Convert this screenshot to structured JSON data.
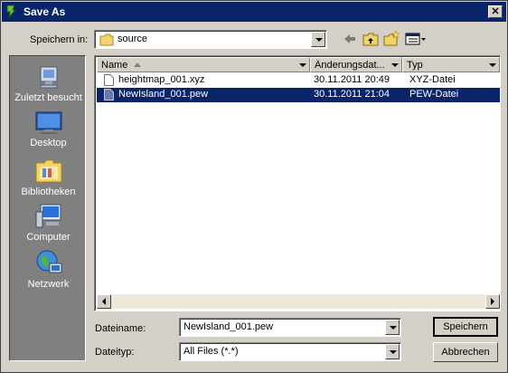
{
  "window": {
    "title": "Save As"
  },
  "location": {
    "label": "Speichern in:",
    "value": "source"
  },
  "toolbar": {
    "back_icon": "back-arrow-icon",
    "up_icon": "folder-up-icon",
    "new_folder_icon": "new-folder-icon",
    "view_icon": "view-menu-icon"
  },
  "places": [
    {
      "label": "Zuletzt besucht",
      "icon": "recent-places-icon"
    },
    {
      "label": "Desktop",
      "icon": "desktop-icon"
    },
    {
      "label": "Bibliotheken",
      "icon": "libraries-icon"
    },
    {
      "label": "Computer",
      "icon": "computer-icon"
    },
    {
      "label": "Netzwerk",
      "icon": "network-icon"
    }
  ],
  "columns": {
    "name": "Name",
    "date": "Änderungsdat...",
    "type": "Typ"
  },
  "files": [
    {
      "name": "heightmap_001.xyz",
      "date": "30.11.2011 20:49",
      "type": "XYZ-Datei",
      "selected": false
    },
    {
      "name": "NewIsland_001.pew",
      "date": "30.11.2011 21:04",
      "type": "PEW-Datei",
      "selected": true
    }
  ],
  "filename": {
    "label": "Dateiname:",
    "value": "NewIsland_001.pew"
  },
  "filetype": {
    "label": "Dateityp:",
    "value": "All Files (*.*)"
  },
  "buttons": {
    "save": "Speichern",
    "cancel": "Abbrechen"
  },
  "colors": {
    "titlebar": "#0a246a",
    "selection": "#0a246a",
    "dialog_bg": "#d4d0c8",
    "places_bg": "#808080"
  }
}
